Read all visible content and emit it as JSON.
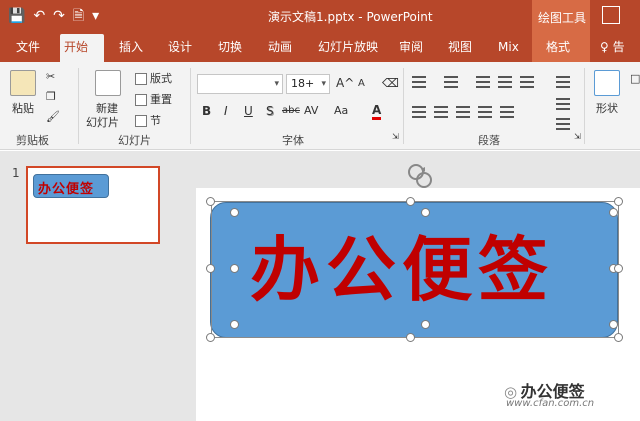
{
  "app": {
    "title": "演示文稿1.pptx - PowerPoint",
    "context_tool_header": "绘图工具",
    "quick_access": [
      "save-icon",
      "undo-icon",
      "redo-icon",
      "new-file-icon",
      "customize-icon"
    ]
  },
  "tabs": [
    {
      "label": "文件"
    },
    {
      "label": "开始",
      "active": true
    },
    {
      "label": "插入"
    },
    {
      "label": "设计"
    },
    {
      "label": "切换"
    },
    {
      "label": "动画"
    },
    {
      "label": "幻灯片放映"
    },
    {
      "label": "审阅"
    },
    {
      "label": "视图"
    },
    {
      "label": "Mix"
    },
    {
      "label": "格式"
    },
    {
      "label": "♀ 告诉"
    }
  ],
  "ribbon": {
    "clipboard": {
      "paste_label": "粘贴",
      "group_label": "剪贴板"
    },
    "slides": {
      "new_slide_line1": "新建",
      "new_slide_line2": "幻灯片",
      "layout_label": "版式",
      "reset_label": "重置",
      "section_label": "节",
      "group_label": "幻灯片"
    },
    "font": {
      "font_name": "",
      "font_size": "18+",
      "bold": "B",
      "italic": "I",
      "underline": "U",
      "shadow": "S",
      "strikethrough": "abc",
      "spacing": "AV",
      "case": "Aa",
      "font_color": "A",
      "grow": "A^",
      "shrink": "A",
      "group_label": "字体"
    },
    "paragraph": {
      "group_label": "段落"
    },
    "drawing": {
      "shape_label": "形状"
    }
  },
  "thumbnails": [
    {
      "number": "1",
      "text": "办公便签"
    }
  ],
  "slide": {
    "shape_text": "办公便签",
    "shape_fill": "#5b9bd5",
    "text_color": "#c00000"
  },
  "watermark": {
    "text": "办公便签",
    "url": "www.cfan.com.cn"
  },
  "colors": {
    "accent": "#b7472a",
    "context_tab": "#d76b45",
    "ribbon_bg": "#f3f3f3",
    "pane_bg": "#e6e6e6"
  }
}
